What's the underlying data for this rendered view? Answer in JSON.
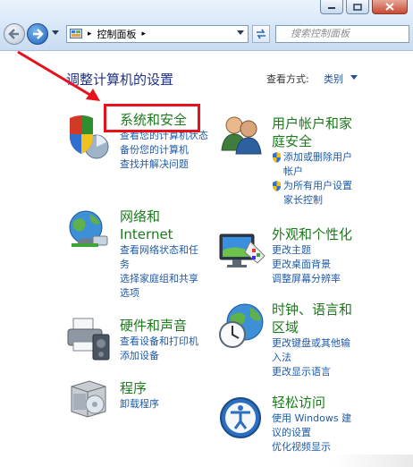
{
  "address_bar": {
    "crumb": "控制面板",
    "search_placeholder": "搜索控制面板"
  },
  "header": {
    "title": "调整计算机的设置",
    "view_by_label": "查看方式:",
    "view_by_value": "类别"
  },
  "categories": {
    "system_security": {
      "title": "系统和安全",
      "links": [
        "查看您的计算机状态",
        "备份您的计算机",
        "查找并解决问题"
      ]
    },
    "user_accounts": {
      "title_line1": "用户帐户和家",
      "title_line2": "庭安全",
      "links": [
        "添加或删除用户",
        "帐户",
        "为所有用户设置",
        "家长控制"
      ]
    },
    "network": {
      "title_line1": "网络和",
      "title_line2": "Internet",
      "links": [
        "查看网络状态和任",
        "务",
        "选择家庭组和共享",
        "选项"
      ]
    },
    "appearance": {
      "title": "外观和个性化",
      "links": [
        "更改主题",
        "更改桌面背景",
        "调整屏幕分辨率"
      ]
    },
    "hardware": {
      "title": "硬件和声音",
      "links": [
        "查看设备和打印机",
        "添加设备"
      ]
    },
    "clock": {
      "title_line1": "时钟、语言和",
      "title_line2": "区域",
      "links": [
        "更改键盘或其他输",
        "入法",
        "更改显示语言"
      ]
    },
    "programs": {
      "title": "程序",
      "links": [
        "卸载程序"
      ]
    },
    "ease": {
      "title": "轻松访问",
      "links": [
        "使用 Windows 建",
        "议的设置",
        "优化视频显示"
      ]
    }
  },
  "colors": {
    "category_title": "#1c7a1c",
    "link": "#1e5ba8",
    "header": "#1e3287",
    "highlight": "#e8101b"
  }
}
